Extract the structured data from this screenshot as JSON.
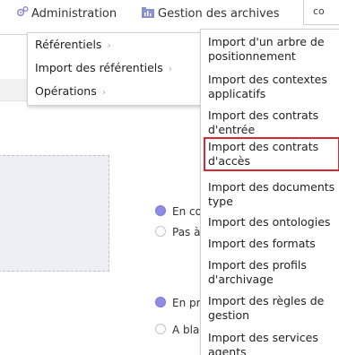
{
  "topbar": {
    "administration_label": "Administration",
    "gestion_label": "Gestion des archives",
    "corner_label": "co"
  },
  "background": {
    "radio_group_1": [
      {
        "label": "En co",
        "selected": true
      },
      {
        "label": "Pas à",
        "selected": false
      }
    ],
    "radio_group_2": [
      {
        "label": "En pr",
        "selected": true
      },
      {
        "label": "A blai",
        "selected": false
      }
    ]
  },
  "menu": {
    "items": [
      {
        "label": "Référentiels",
        "chevron": "›"
      },
      {
        "label": "Import des référentiels",
        "chevron": "›"
      },
      {
        "label": "Opérations",
        "chevron": "›"
      }
    ]
  },
  "submenu": {
    "items": [
      {
        "label": "Import d'un arbre de positionnement",
        "selected": false
      },
      {
        "label": "Import des contextes applicatifs",
        "selected": false
      },
      {
        "label": "Import des contrats d'entrée",
        "selected": false
      },
      {
        "label": "Import des contrats d'accès",
        "selected": true
      },
      {
        "label": "Import des documents type",
        "selected": false
      },
      {
        "label": "Import des ontologies",
        "selected": false
      },
      {
        "label": "Import des formats",
        "selected": false
      },
      {
        "label": "Import des profils d'archivage",
        "selected": false
      },
      {
        "label": "Import des règles de gestion",
        "selected": false
      },
      {
        "label": "Import des services agents",
        "selected": false
      }
    ]
  },
  "colors": {
    "accent": "#8f8ce6",
    "chevron": "#a8a8e8",
    "highlight_border": "#d9282f"
  },
  "icons": {
    "administration": "gears-icon",
    "gestion": "folder-chart-icon"
  }
}
